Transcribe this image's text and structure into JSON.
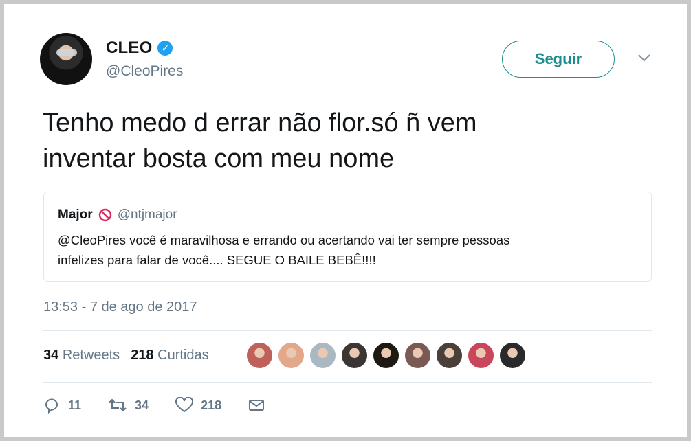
{
  "author": {
    "name": "CLEO",
    "handle": "@CleoPires",
    "verified_icon": "verified-check-icon"
  },
  "follow_button": {
    "label": "Seguir"
  },
  "tweet": {
    "line1": "Tenho medo d errar não flor.só ñ vem",
    "line2": "inventar bosta com meu nome"
  },
  "quoted_tweet": {
    "name": "Major",
    "badge_icon": "no-entry-icon",
    "handle": "@ntjmajor",
    "line1": "@CleoPires você é maravilhosa e errando ou acertando vai ter sempre pessoas",
    "line2": "infelizes para falar de você.... SEGUE O BAILE BEBÊ!!!!"
  },
  "timestamp": "13:53 - 7 de ago de 2017",
  "stats": {
    "retweets_count": "34",
    "retweets_label": "Retweets",
    "likes_count": "218",
    "likes_label": "Curtidas"
  },
  "liker_avatars": [
    {
      "color": "#c0605a"
    },
    {
      "color": "#e3a88a"
    },
    {
      "color": "#aab8c2"
    },
    {
      "color": "#3a3633"
    },
    {
      "color": "#1d1a14"
    },
    {
      "color": "#7a5a52"
    },
    {
      "color": "#4a403a"
    },
    {
      "color": "#c8475a"
    },
    {
      "color": "#2a2a2a"
    }
  ],
  "actions": {
    "reply_count": "11",
    "retweet_count": "34",
    "like_count": "218"
  },
  "colors": {
    "accent": "#1c8c8f",
    "verified": "#1da1f2",
    "muted": "#657786",
    "no_entry": "#e0245e"
  }
}
